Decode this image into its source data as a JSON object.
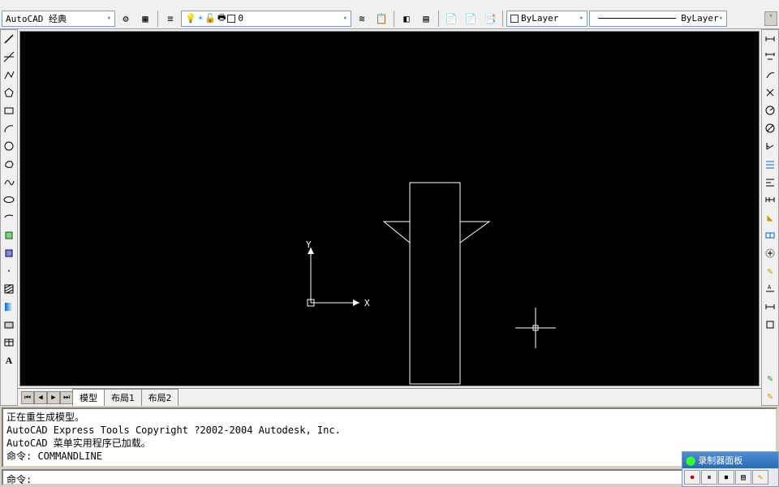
{
  "toolbar": {
    "workspace": "AutoCAD 经典",
    "layer_current": "0",
    "color_current": "ByLayer",
    "linetype_current": "ByLayer"
  },
  "tabs": {
    "model": "模型",
    "layout1": "布局1",
    "layout2": "布局2"
  },
  "ucs": {
    "x": "X",
    "y": "Y"
  },
  "cmd": {
    "line1": "正在重生成模型。",
    "line2": "AutoCAD Express Tools Copyright ?2002-2004 Autodesk, Inc.",
    "line3": "AutoCAD 菜单实用程序已加载。",
    "line4": "命令: COMMANDLINE",
    "prompt": "命令:"
  },
  "recorder": {
    "title": "录制器面板"
  },
  "icons": {
    "line": "╱",
    "pline": "⌒",
    "polygon": "⬠",
    "rect": "▭",
    "arc": "⌒",
    "circle": "○",
    "spline": "∿",
    "ellipse": "⬭",
    "hatch": "▦",
    "point": "·",
    "text": "A",
    "dim1": "⟼",
    "dim2": "⟼",
    "dim3": "⟋",
    "dim4": "↔",
    "zoom": "⊕",
    "pan": "✋",
    "orbit": "⟲"
  }
}
